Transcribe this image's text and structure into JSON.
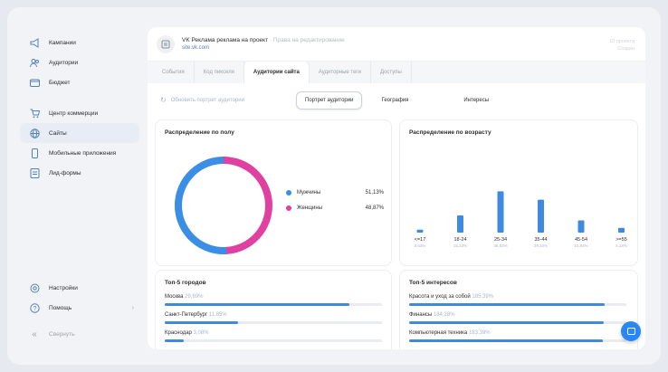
{
  "colors": {
    "accent": "#3f8ae0",
    "male": "#3a8ee6",
    "female": "#e040a0",
    "bg": "#f1f3f6"
  },
  "sidebar": {
    "top_items": [
      {
        "label": "Кампании",
        "icon": "megaphone-icon"
      },
      {
        "label": "Аудитории",
        "icon": "users-icon"
      },
      {
        "label": "Бюджет",
        "icon": "wallet-icon"
      }
    ],
    "mid_items": [
      {
        "label": "Центр коммерции",
        "icon": "cart-icon"
      },
      {
        "label": "Сайты",
        "icon": "globe-icon"
      },
      {
        "label": "Мобильные приложения",
        "icon": "phone-icon"
      },
      {
        "label": "Лид-формы",
        "icon": "form-icon"
      }
    ],
    "bottom_items": [
      {
        "label": "Настройки",
        "icon": "gear-icon"
      },
      {
        "label": "Помощь",
        "icon": "help-icon"
      },
      {
        "label": "Свернуть",
        "icon": "collapse-icon"
      }
    ]
  },
  "header": {
    "title": "VK Реклама реклама на проект",
    "subtitle": "· Права на редактирование",
    "link": "site.vk.com",
    "right_line1": "ID проекта",
    "right_line2": "Создан"
  },
  "tabs": [
    "События",
    "Код пикселя",
    "Аудитории сайта",
    "Аудиторные теги",
    "Доступы"
  ],
  "toolbar": {
    "update_label": "Обновить портрет аудитории",
    "segments": [
      "Портрет аудитории",
      "География",
      "Интересы"
    ]
  },
  "gender_panel": {
    "title": "Распределение по полу",
    "legend": [
      {
        "name": "Мужчины",
        "value": "51,13%"
      },
      {
        "name": "Женщины",
        "value": "48,87%"
      }
    ]
  },
  "age_panel": {
    "title": "Распределение по возрасту"
  },
  "chart_data": [
    {
      "type": "pie",
      "title": "Распределение по полу",
      "labels": [
        "Мужчины",
        "Женщины"
      ],
      "values": [
        51.13,
        48.87
      ]
    },
    {
      "type": "bar",
      "title": "Распределение по возрасту",
      "categories": [
        "<=17",
        "18-24",
        "25-34",
        "35-44",
        "45-54",
        ">=55"
      ],
      "category_pct": [
        "2,63%",
        "15,23%",
        "36,53%",
        "29,10%",
        "10,84%",
        "4,18%"
      ],
      "values": [
        2.63,
        15.23,
        36.53,
        29.1,
        10.84,
        4.18
      ]
    }
  ],
  "cities_panel": {
    "title": "Топ-5 городов",
    "rows": [
      {
        "name": "Москва",
        "pct": "29,69%",
        "value": 29.69
      },
      {
        "name": "Санкт-Петербург",
        "pct": "11,85%",
        "value": 11.85
      },
      {
        "name": "Краснодар",
        "pct": "3,08%",
        "value": 3.08
      }
    ]
  },
  "interests_panel": {
    "title": "Топ-5 интересов",
    "rows": [
      {
        "name": "Красота и уход за собой",
        "pct": "185,39%",
        "value": 185.39
      },
      {
        "name": "Финансы",
        "pct": "184,28%",
        "value": 184.28
      },
      {
        "name": "Компьютерная техника",
        "pct": "183,39%",
        "value": 183.39
      }
    ]
  }
}
